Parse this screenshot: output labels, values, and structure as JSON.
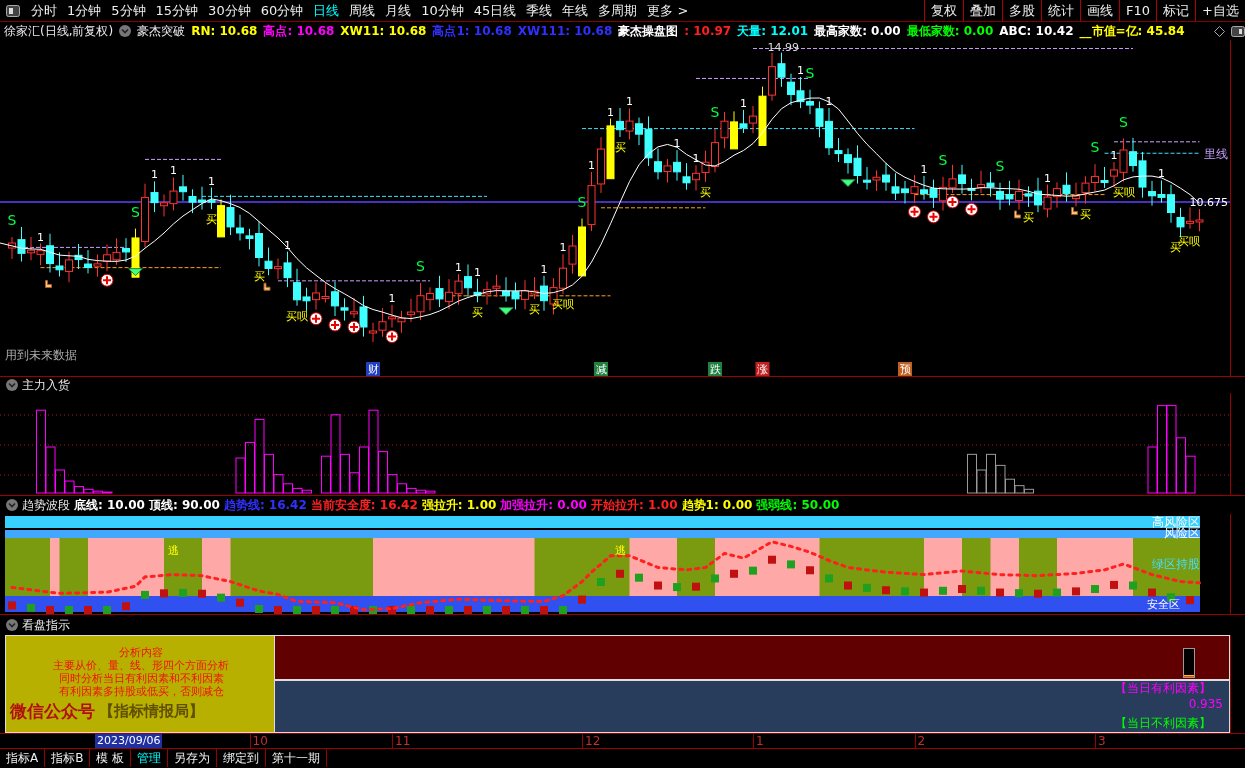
{
  "toolbar": {
    "periods": [
      {
        "label": "分时",
        "selected": false
      },
      {
        "label": "1分钟",
        "selected": false
      },
      {
        "label": "5分钟",
        "selected": false
      },
      {
        "label": "15分钟",
        "selected": false
      },
      {
        "label": "30分钟",
        "selected": false
      },
      {
        "label": "60分钟",
        "selected": false
      },
      {
        "label": "日线",
        "selected": true
      },
      {
        "label": "周线",
        "selected": false
      },
      {
        "label": "月线",
        "selected": false
      },
      {
        "label": "10分钟",
        "selected": false
      },
      {
        "label": "45日线",
        "selected": false
      },
      {
        "label": "季线",
        "selected": false
      },
      {
        "label": "年线",
        "selected": false
      },
      {
        "label": "多周期",
        "selected": false
      },
      {
        "label": "更多 >",
        "selected": false
      }
    ],
    "buttons": [
      "复权",
      "叠加",
      "多股",
      "统计",
      "画线",
      "F10",
      "标记",
      "+自选"
    ]
  },
  "main_chart": {
    "title": "徐家汇(日线,前复权)",
    "indicator": "豪杰突破",
    "readings": [
      {
        "text": "RN: 10.68",
        "color": "#ffff00"
      },
      {
        "text": "高点: 10.68",
        "color": "#ff00ff"
      },
      {
        "text": "XW11: 10.68",
        "color": "#ffff00"
      },
      {
        "text": "高点1: 10.68",
        "color": "#3030ff"
      },
      {
        "text": "XW111: 10.68",
        "color": "#3030ff"
      },
      {
        "text": "豪杰操盘图",
        "color": "#ffffff"
      },
      {
        "text": ": 10.97",
        "color": "#ff2020"
      },
      {
        "text": "天量: 12.01",
        "color": "#00ffff"
      },
      {
        "text": "最高家数: 0.00",
        "color": "#ffffff"
      },
      {
        "text": "最低家数: 0.00",
        "color": "#00ff00"
      },
      {
        "text": "ABC: 10.42",
        "color": "#ffffff"
      },
      {
        "text": "__市值=亿: 45.84",
        "color": "#ffff00"
      }
    ],
    "price_labels": [
      {
        "text": "14.99",
        "kind": "peak"
      },
      {
        "text": "里线",
        "kind": "line"
      },
      {
        "text": "10.675",
        "kind": "level"
      }
    ],
    "signals": [
      {
        "text": "S",
        "kind": "sell"
      },
      {
        "text": "S",
        "kind": "sell"
      },
      {
        "text": "S",
        "kind": "sell"
      },
      {
        "text": "S",
        "kind": "sell"
      },
      {
        "text": "S",
        "kind": "sell"
      },
      {
        "text": "S",
        "kind": "sell"
      },
      {
        "text": "S",
        "kind": "sell"
      },
      {
        "text": "S",
        "kind": "sell"
      },
      {
        "text": "S",
        "kind": "sell"
      },
      {
        "text": "S",
        "kind": "sell"
      },
      {
        "text": "1",
        "kind": "count"
      },
      {
        "text": "1",
        "kind": "count"
      },
      {
        "text": "1",
        "kind": "count"
      },
      {
        "text": "1",
        "kind": "count"
      },
      {
        "text": "1",
        "kind": "count"
      },
      {
        "text": "1",
        "kind": "count"
      },
      {
        "text": "1",
        "kind": "count"
      },
      {
        "text": "1",
        "kind": "count"
      },
      {
        "text": "1",
        "kind": "count"
      },
      {
        "text": "1",
        "kind": "count"
      },
      {
        "text": "1",
        "kind": "count"
      },
      {
        "text": "1",
        "kind": "count"
      },
      {
        "text": "1",
        "kind": "count"
      },
      {
        "text": "1",
        "kind": "count"
      },
      {
        "text": "1",
        "kind": "count"
      },
      {
        "text": "1",
        "kind": "count"
      },
      {
        "text": "1",
        "kind": "count"
      },
      {
        "text": "1",
        "kind": "count"
      },
      {
        "text": "1",
        "kind": "count"
      },
      {
        "text": "1",
        "kind": "count"
      },
      {
        "text": "1",
        "kind": "count"
      },
      {
        "text": "1",
        "kind": "count"
      },
      {
        "text": "买",
        "kind": "buy"
      },
      {
        "text": "买",
        "kind": "buy"
      },
      {
        "text": "买呗",
        "kind": "buy"
      },
      {
        "text": "买",
        "kind": "buy"
      },
      {
        "text": "买",
        "kind": "buy"
      },
      {
        "text": "买呗",
        "kind": "buy"
      },
      {
        "text": "买",
        "kind": "buy"
      },
      {
        "text": "买",
        "kind": "buy"
      },
      {
        "text": "买",
        "kind": "buy"
      },
      {
        "text": "买",
        "kind": "buy"
      },
      {
        "text": "买呗",
        "kind": "buy"
      },
      {
        "text": "买",
        "kind": "buy"
      },
      {
        "text": "买呗",
        "kind": "buy"
      }
    ],
    "note": "用到未来数据",
    "events": [
      {
        "text": "财",
        "color": "#2040c0"
      },
      {
        "text": "减",
        "color": "#208040"
      },
      {
        "text": "跌",
        "color": "#208040"
      },
      {
        "text": "涨",
        "color": "#c02020"
      },
      {
        "text": "预",
        "color": "#c06020"
      }
    ]
  },
  "volume_panel": {
    "title": "主力入货"
  },
  "trend_panel": {
    "title": "趋势波段",
    "readings": [
      {
        "text": "底线: 10.00",
        "color": "#ffffff"
      },
      {
        "text": "顶线: 90.00",
        "color": "#ffffff"
      },
      {
        "text": "趋势线: 16.42",
        "color": "#3030ff"
      },
      {
        "text": "当前安全度: 16.42",
        "color": "#ff2020"
      },
      {
        "text": "强拉升: 1.00",
        "color": "#ffff00"
      },
      {
        "text": "加强拉升: 0.00",
        "color": "#ff00ff"
      },
      {
        "text": "开始拉升: 1.00",
        "color": "#ff2020"
      },
      {
        "text": "趋势1: 0.00",
        "color": "#ffff00"
      },
      {
        "text": "强弱线: 50.00",
        "color": "#00ff00"
      }
    ],
    "zones": [
      "高风险区",
      "风险区",
      "绿区持股",
      "安全区"
    ],
    "escapes": [
      "逃",
      "逃"
    ]
  },
  "advice_panel": {
    "title": "看盘指示",
    "lines": [
      "分析内容",
      "主要从价、量、线、形四个方面分析",
      "同时分析当日有利因素和不利因素",
      "有利因素多持股或低买，否则减仓"
    ],
    "account": "微信公众号",
    "brand": "【指标情报局】",
    "positive": "【当日有利因素】",
    "value": "0.935",
    "negative": "【当日不利因素】",
    "level": 0.08
  },
  "x_axis": {
    "date": "2023/09/06",
    "labels": [
      "10",
      "11",
      "12",
      "1",
      "2",
      "3"
    ]
  },
  "bottom_tabs": [
    {
      "label": "指标A",
      "selected": false
    },
    {
      "label": "指标B",
      "selected": false
    },
    {
      "label": "模 板",
      "selected": false
    },
    {
      "label": "管理",
      "selected": true
    },
    {
      "label": "另存为",
      "selected": false
    },
    {
      "label": "绑定到",
      "selected": false
    },
    {
      "label": "第十一期",
      "selected": false
    }
  ]
}
